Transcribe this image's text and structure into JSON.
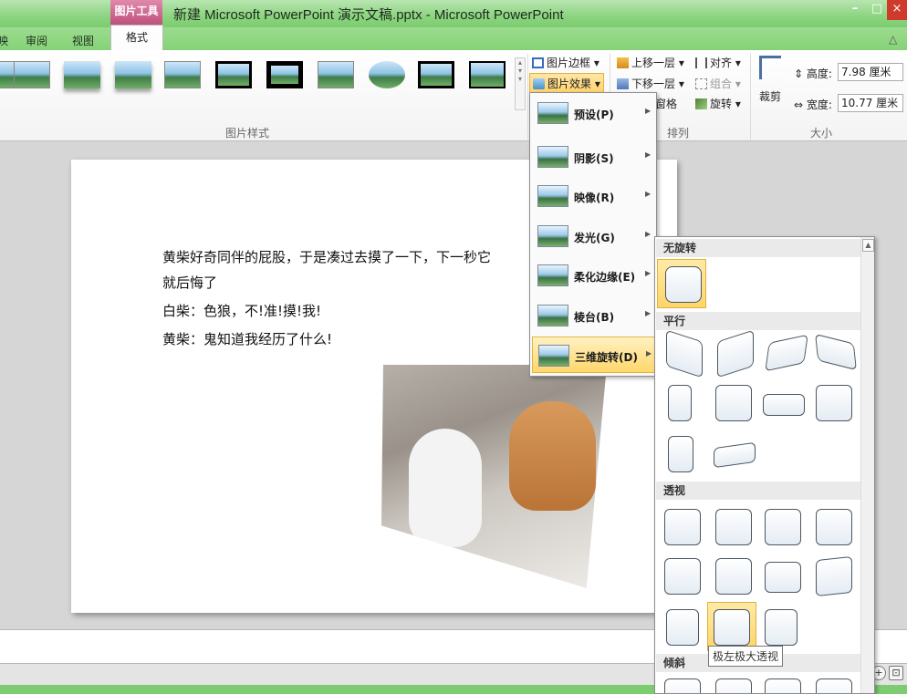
{
  "window": {
    "title": "新建 Microsoft PowerPoint 演示文稿.pptx - Microsoft PowerPoint",
    "tools_context": "图片工具"
  },
  "tabs": [
    "审阅",
    "视图"
  ],
  "active_tab": "格式",
  "ribbon": {
    "picture_styles_label": "图片样式",
    "arrange_label": "排列",
    "size_label": "大小",
    "picture_border": "图片边框",
    "picture_effects": "图片效果",
    "bring_forward": "上移一层",
    "send_backward": "下移一层",
    "selection_pane": "窗格",
    "align": "对齐",
    "group": "组合",
    "rotate": "旋转",
    "crop": "裁剪",
    "height_label": "高度:",
    "height_value": "7.98 厘米",
    "width_label": "宽度:",
    "width_value": "10.77 厘米"
  },
  "slide": {
    "lines": [
      "黄柴好奇同伴的屁股，于是凑过去摸了一下，下一秒它",
      "就后悔了",
      "白柴：色狼，不!准!摸!我!",
      "黄柴：鬼知道我经历了什么!"
    ]
  },
  "effects_menu": [
    {
      "label": "预设(P)"
    },
    {
      "label": "阴影(S)"
    },
    {
      "label": "映像(R)"
    },
    {
      "label": "发光(G)"
    },
    {
      "label": "柔化边缘(E)"
    },
    {
      "label": "棱台(B)"
    },
    {
      "label": "三维旋转(D)",
      "selected": true
    }
  ],
  "rotation_submenu": {
    "sections": [
      "无旋转",
      "平行",
      "透视",
      "倾斜"
    ],
    "tooltip": "极左极大透视"
  },
  "colors": {
    "title_bar": "#8cd480",
    "tools_tag": "#c0507d",
    "highlight": "#ffd76b"
  }
}
